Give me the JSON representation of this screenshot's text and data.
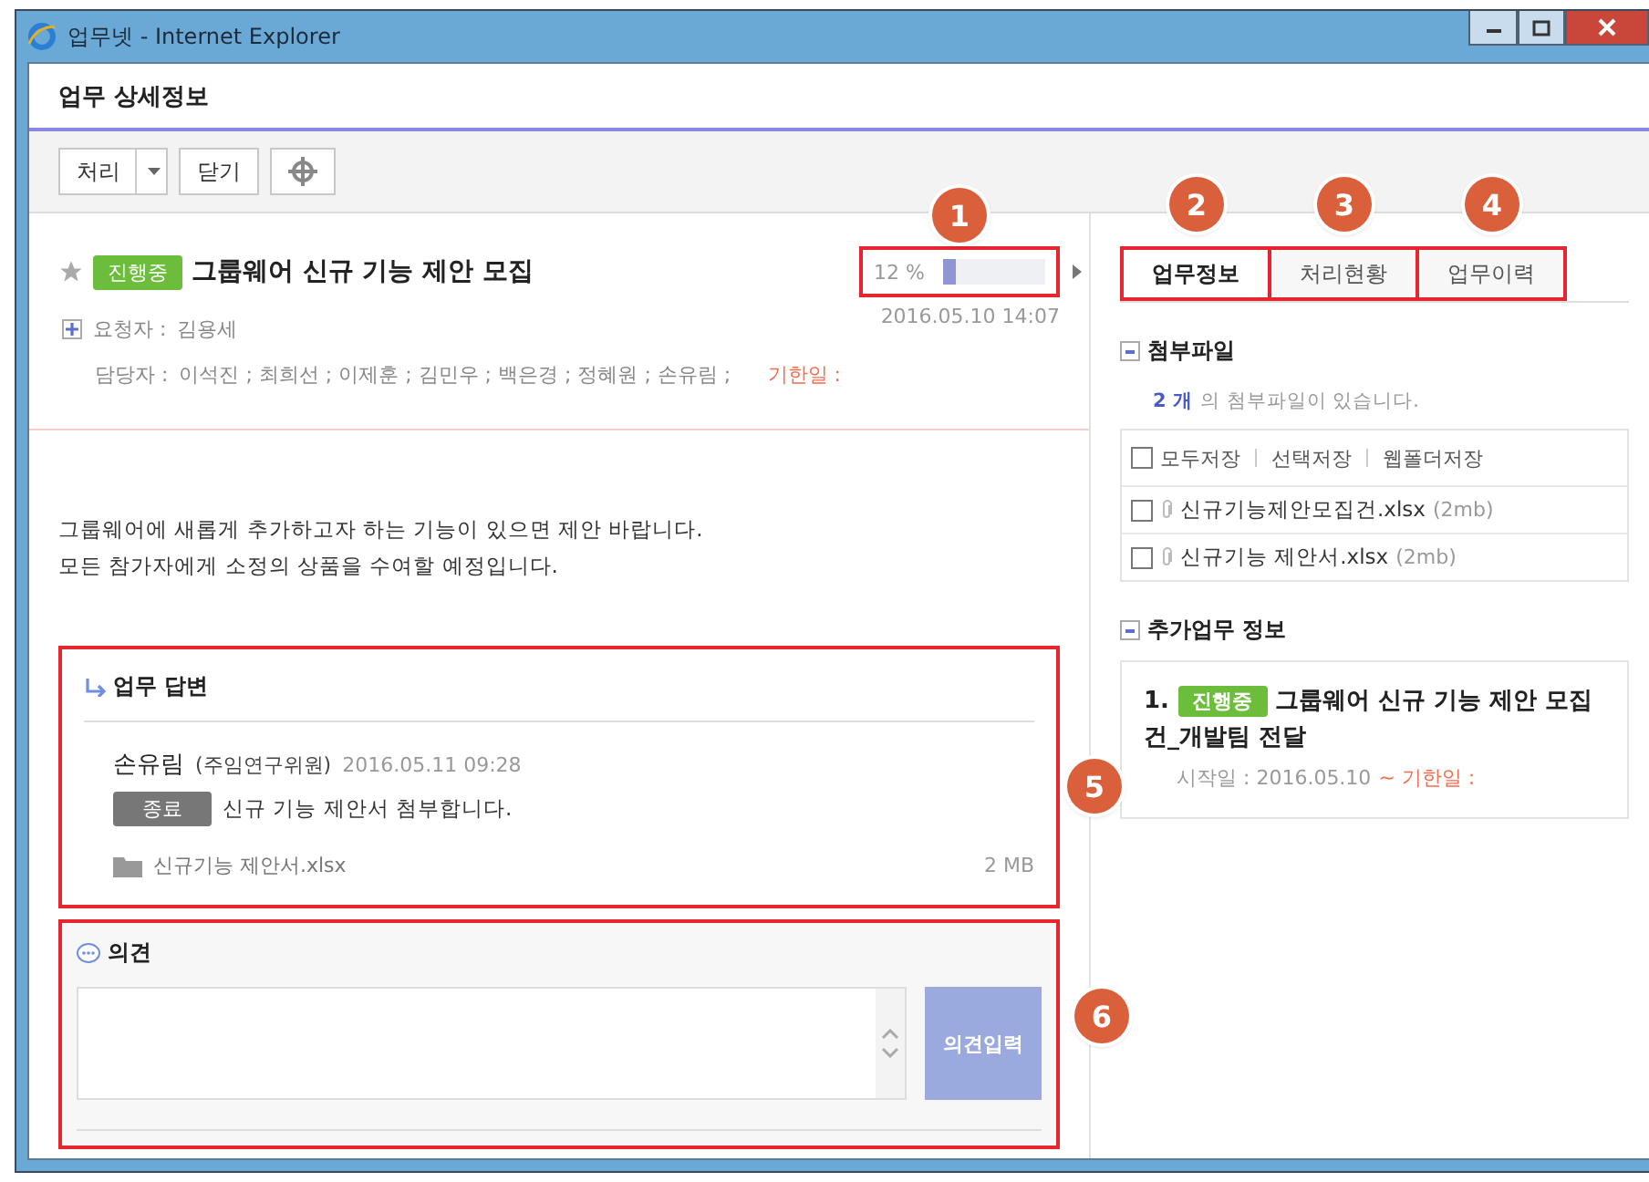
{
  "window": {
    "title": "업무넷 - Internet Explorer"
  },
  "page_title": "업무 상세정보",
  "toolbar": [
    {
      "kind": "split",
      "label": "처리"
    },
    {
      "kind": "plain",
      "label": "닫기"
    },
    {
      "kind": "icon"
    }
  ],
  "task": {
    "starred": false,
    "status": {
      "label": "진행중",
      "color": "#6cbd3c"
    },
    "title": "그룹웨어 신규 기능 제안 모집",
    "progress": {
      "reading": "12 %",
      "level": 0.12,
      "callout": "1"
    },
    "date": "2016.05.10 14:07",
    "requester_label": "요청자 :",
    "requester": "김용세",
    "assignee_label": "담당자 :",
    "assignees": "이석진 ; 최희선 ; 이제훈 ; 김민우 ; 백은경 ; 정혜원 ; 손유림 ;",
    "due_label": "기한일 :",
    "description": [
      "그룹웨어에 새롭게 추가하고자 하는 기능이 있으면 제안 바랍니다.",
      "모든 참가자에게 소정의 상품을 수여할 예정입니다."
    ]
  },
  "reply": {
    "callout": "5",
    "title": "업무 답변",
    "author": "손유림",
    "position": "(주임연구위원)",
    "date": "2016.05.11 09:28",
    "status": {
      "label": "종료",
      "color": "#777777"
    },
    "message": "신규 기능 제안서 첨부합니다.",
    "file": {
      "name": "신규기능 제안서.xlsx",
      "size": "2 MB"
    }
  },
  "comment": {
    "callout": "6",
    "title": "의견",
    "button": "의견입력"
  },
  "tabs": [
    {
      "label": "업무정보",
      "selected": true,
      "callout": "2"
    },
    {
      "label": "처리현황",
      "selected": false,
      "callout": "3"
    },
    {
      "label": "업무이력",
      "selected": false,
      "callout": "4"
    }
  ],
  "attachments": {
    "title": "첨부파일",
    "count": "2 개",
    "count_text": "의 첨부파일이 있습니다.",
    "select_all": false,
    "actions": [
      "모두저장",
      "선택저장",
      "웹폴더저장"
    ],
    "files": [
      {
        "name": "신규기능제안모집건.xlsx",
        "size": "(2mb)",
        "checked": false
      },
      {
        "name": "신규기능 제안서.xlsx",
        "size": "(2mb)",
        "checked": false
      }
    ]
  },
  "extra": {
    "title": "추가업무 정보",
    "items": [
      {
        "number": "1.",
        "status": {
          "label": "진행중",
          "color": "#6cbd3c"
        },
        "title": "그룹웨어 신규 기능 제안 모집 건_개발팀 전달",
        "start": "시작일 : 2016.05.10",
        "due": "~ 기한일 :"
      }
    ]
  }
}
